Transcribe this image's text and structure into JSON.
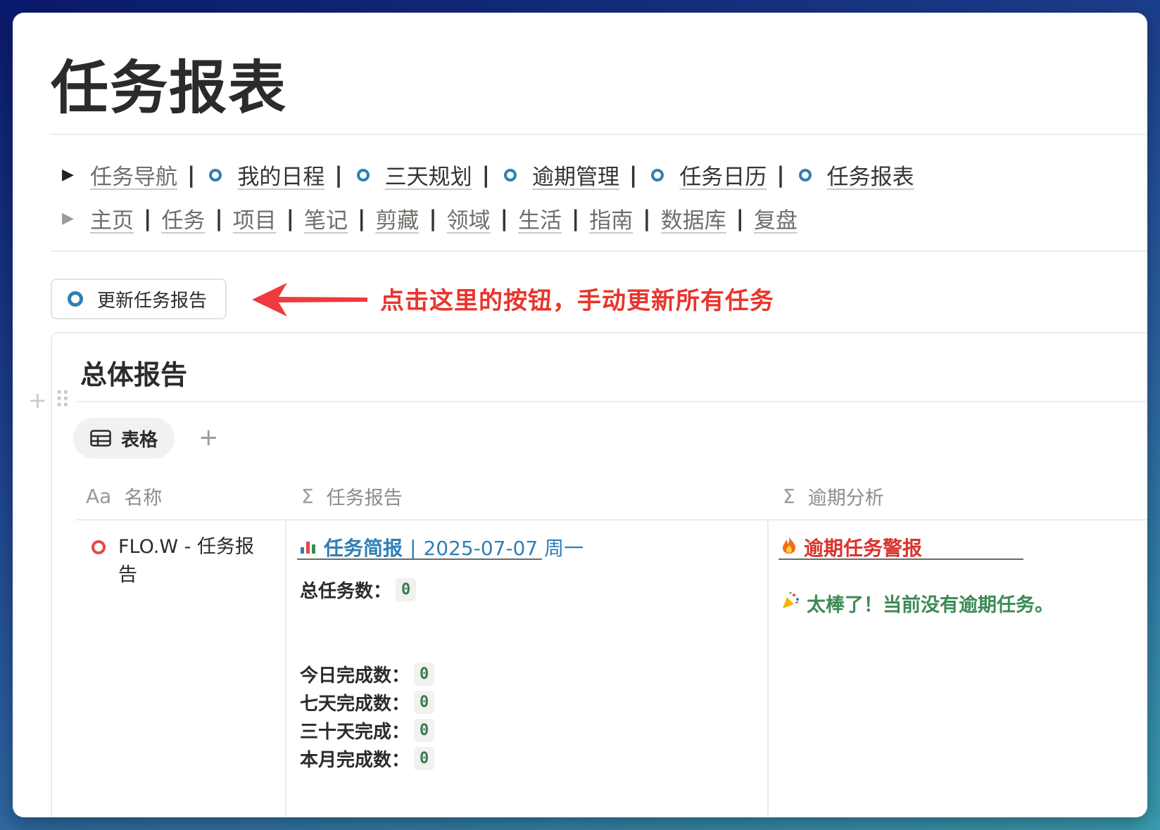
{
  "page": {
    "title": "任务报表"
  },
  "nav_row1": {
    "toggle": "▶",
    "items": [
      {
        "label": "任务导航",
        "has_icon": false
      },
      {
        "label": "我的日程",
        "has_icon": true
      },
      {
        "label": "三天规划",
        "has_icon": true
      },
      {
        "label": "逾期管理",
        "has_icon": true
      },
      {
        "label": "任务日历",
        "has_icon": true
      },
      {
        "label": "任务报表",
        "has_icon": true
      }
    ],
    "separator": "|"
  },
  "nav_row2": {
    "toggle": "▶",
    "items": [
      "主页",
      "任务",
      "项目",
      "笔记",
      "剪藏",
      "领域",
      "生活",
      "指南",
      "数据库",
      "复盘"
    ],
    "separator": "|"
  },
  "update_button": {
    "label": "更新任务报告"
  },
  "annotation": {
    "text": "点击这里的按钮，手动更新所有任务",
    "color": "#e8352c"
  },
  "report": {
    "title": "总体报告",
    "view_tab": "表格",
    "add_view": "+",
    "columns": [
      {
        "icon": "Aa",
        "label": "名称"
      },
      {
        "icon": "Σ",
        "label": "任务报告"
      },
      {
        "icon": "Σ",
        "label": "逾期分析"
      }
    ],
    "row": {
      "name": "FLO.W - 任务报告",
      "task_report": {
        "icon": "📊",
        "heading": "任务简报",
        "separator": "|",
        "date": "2025-07-07 周一",
        "total_label": "总任务数：",
        "total_value": "0",
        "stats": [
          {
            "label": "今日完成数：",
            "value": "0"
          },
          {
            "label": "七天完成数：",
            "value": "0"
          },
          {
            "label": "三十天完成：",
            "value": "0"
          },
          {
            "label": "本月完成数：",
            "value": "0"
          }
        ]
      },
      "overdue": {
        "icon": "🔥",
        "heading": "逾期任务警报",
        "msg_icon": "🎉",
        "message": "太棒了！当前没有逾期任务。"
      }
    }
  },
  "colors": {
    "accent_blue": "#2f7fb5",
    "red": "#d8342c",
    "green": "#3b8a55"
  }
}
